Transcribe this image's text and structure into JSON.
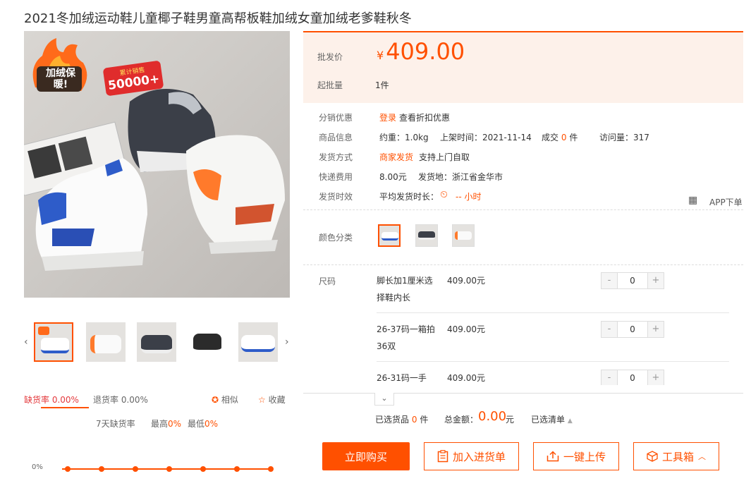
{
  "title": "2021冬加绒运动鞋儿童椰子鞋男童高帮板鞋加绒女童加绒老爹鞋秋冬",
  "gallery": {
    "main_image_alt": "kids high-top sneakers product photo",
    "badge_text": "加绒保暖!",
    "badge_sales_label": "累计销售",
    "badge_sales_value": "50000+",
    "prev_icon": "chevron-left-icon",
    "next_icon": "chevron-right-icon",
    "thumb_count": 5
  },
  "metrics": {
    "shortage_rate": "缺货率 0.00%",
    "return_rate": "退货率 0.00%",
    "similar": "相似",
    "favorite": "收藏",
    "seven_day_label": "7天缺货率",
    "max_label": "最高",
    "max_value": "0%",
    "min_label": "最低",
    "min_value": "0%",
    "chart_axis_label": "0%"
  },
  "price": {
    "wholesale_label": "批发价",
    "currency": "¥",
    "value": "409.00",
    "moq_label": "起批量",
    "moq_value": "1件"
  },
  "info": {
    "distribution_label": "分销优惠",
    "login_link": "登录",
    "discount_text": "查看折扣优惠",
    "product_info_label": "商品信息",
    "weight": "约重：1.0kg",
    "listed": "上架时间：2021-11-14",
    "deals_label": "成交",
    "deals_value": "0",
    "deals_unit": "件",
    "visits": "访问量：317",
    "shipping_label": "发货方式",
    "shipping_seller": "商家发货",
    "shipping_pickup": "支持上门自取",
    "fee_label": "快递费用",
    "fee_value": "8.00元",
    "origin": "发货地：浙江省金华市",
    "time_label": "发货时效",
    "avg_time": "平均发货时长：",
    "avg_value": "-- 小时",
    "app_order": "APP下单"
  },
  "color": {
    "label": "颜色分类",
    "swatch_count": 3
  },
  "sizes": {
    "label": "尺码",
    "rows": [
      {
        "name": "脚长加1厘米选择鞋内长",
        "price": "409.00元",
        "qty": "0"
      },
      {
        "name": "26-37码一箱拍36双",
        "price": "409.00元",
        "qty": "0"
      },
      {
        "name": "26-31码一手",
        "price": "409.00元",
        "qty": "0"
      }
    ],
    "minus": "-",
    "plus": "+"
  },
  "summary": {
    "selected_label": "已选货品",
    "selected_value": "0",
    "selected_unit": "件",
    "total_label": "总金额：",
    "total_value": "0.00",
    "total_unit": "元",
    "list_label": "已选清单"
  },
  "actions": {
    "buy_now": "立即购买",
    "add_to_cart": "加入进货单",
    "upload": "一键上传",
    "toolbox": "工具箱"
  },
  "colors": {
    "accent": "#ff5000",
    "price_bg": "#fdf1ea",
    "text": "#333333",
    "muted": "#666666"
  }
}
